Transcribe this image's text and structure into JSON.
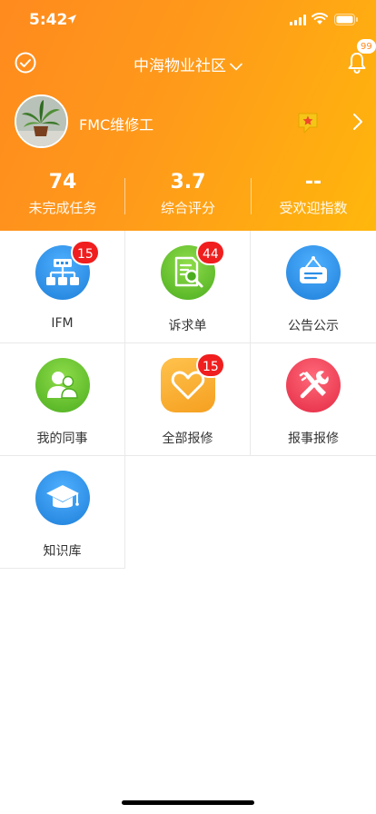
{
  "status_bar": {
    "time": "5:42"
  },
  "nav": {
    "community": "中海物业社区",
    "notification_count": "99"
  },
  "profile": {
    "name": "FMC维修工"
  },
  "stats": [
    {
      "value": "74",
      "label": "未完成任务"
    },
    {
      "value": "3.7",
      "label": "综合评分"
    },
    {
      "value": "--",
      "label": "受欢迎指数"
    }
  ],
  "modules": [
    {
      "label": "IFM",
      "badge": "15",
      "icon": "org-chart-icon",
      "color": "#2f8ee6"
    },
    {
      "label": "诉求单",
      "badge": "44",
      "icon": "document-search-icon",
      "color": "#5cc12e"
    },
    {
      "label": "公告公示",
      "badge": "",
      "icon": "notice-board-icon",
      "color": "#2a8fe6"
    },
    {
      "label": "我的同事",
      "badge": "",
      "icon": "colleagues-icon",
      "color": "#5cc12e"
    },
    {
      "label": "全部报修",
      "badge": "15",
      "icon": "heart-icon",
      "color": "#f7a52b"
    },
    {
      "label": "报事报修",
      "badge": "",
      "icon": "tools-icon",
      "color": "#f03a52"
    },
    {
      "label": "知识库",
      "badge": "",
      "icon": "graduation-cap-icon",
      "color": "#2a8fe6"
    }
  ],
  "colors": {
    "header_start": "#ff8a1e",
    "header_end": "#ffb70c",
    "badge": "#f01e1e"
  }
}
